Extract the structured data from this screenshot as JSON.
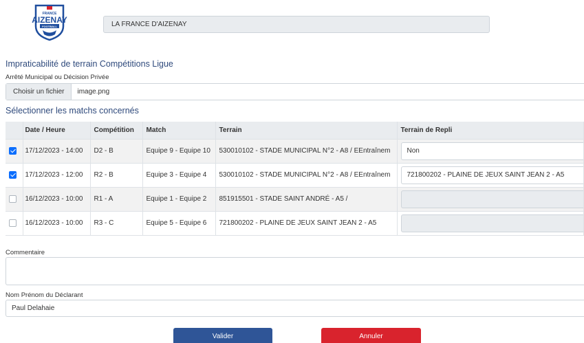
{
  "logo": {
    "text_top": "FRANCE",
    "text_main": "AIZENAY",
    "text_bottom": "FOOTBALL"
  },
  "club_name": "LA FRANCE D'AIZENAY",
  "form_title": "Impraticabilité de terrain Compétitions Ligue",
  "file_label": "Arrêté Municipal ou Décision Privée",
  "file_button": "Choisir un fichier",
  "file_name": "image.png",
  "matches_title": "Sélectionner les matchs concernés",
  "table": {
    "headers": [
      "Date / Heure",
      "Compétition",
      "Match",
      "Terrain",
      "Terrain de Repli"
    ],
    "rows": [
      {
        "checked": true,
        "date": "17/12/2023 - 14:00",
        "competition": "D2 - B",
        "match": "Equipe 9 - Equipe 10",
        "terrain": "530010102 - STADE MUNICIPAL N°2 - A8 / EEntraînem",
        "repli": "Non"
      },
      {
        "checked": true,
        "date": "17/12/2023 - 12:00",
        "competition": "R2 - B",
        "match": "Equipe 3 - Equipe 4",
        "terrain": "530010102 - STADE MUNICIPAL N°2 - A8 / EEntraînem",
        "repli": "721800202 - PLAINE DE JEUX SAINT JEAN 2 - A5"
      },
      {
        "checked": false,
        "date": "16/12/2023 - 10:00",
        "competition": "R1 - A",
        "match": "Equipe 1 - Equipe 2",
        "terrain": "851915501 - STADE SAINT ANDRÉ - A5 /",
        "repli": ""
      },
      {
        "checked": false,
        "date": "16/12/2023 - 10:00",
        "competition": "R3 - C",
        "match": "Equipe 5 - Equipe 6",
        "terrain": "721800202 - PLAINE DE JEUX SAINT JEAN 2 - A5",
        "repli": ""
      }
    ]
  },
  "comment_label": "Commentaire",
  "comment_value": "",
  "declarant_label": "Nom Prénom du Déclarant",
  "declarant_value": "Paul Delahaie",
  "submit_label": "Valider",
  "cancel_label": "Annuler",
  "colors": {
    "primary": "#2f5597",
    "danger": "#d9232d",
    "title": "#2f4a7c",
    "checkbox": "#0d6efd"
  }
}
